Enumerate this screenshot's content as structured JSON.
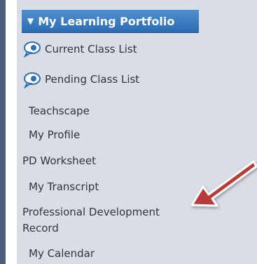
{
  "panel": {
    "header": "My Learning Portfolio",
    "header_arrow": "▼",
    "items": [
      {
        "label": "Current Class List",
        "icon": "chat-bubble-icon"
      },
      {
        "label": "Pending Class List",
        "icon": "chat-bubble-icon"
      },
      {
        "label": "Teachscape"
      },
      {
        "label": "My Profile"
      },
      {
        "label": "PD Worksheet"
      },
      {
        "label": "My Transcript"
      },
      {
        "label": "Professional Development"
      },
      {
        "label": "Record"
      },
      {
        "label": "My Calendar"
      }
    ]
  },
  "colors": {
    "header": "#2c6db3",
    "panel": "#d9dde5",
    "arrow": "#b83a3a"
  }
}
